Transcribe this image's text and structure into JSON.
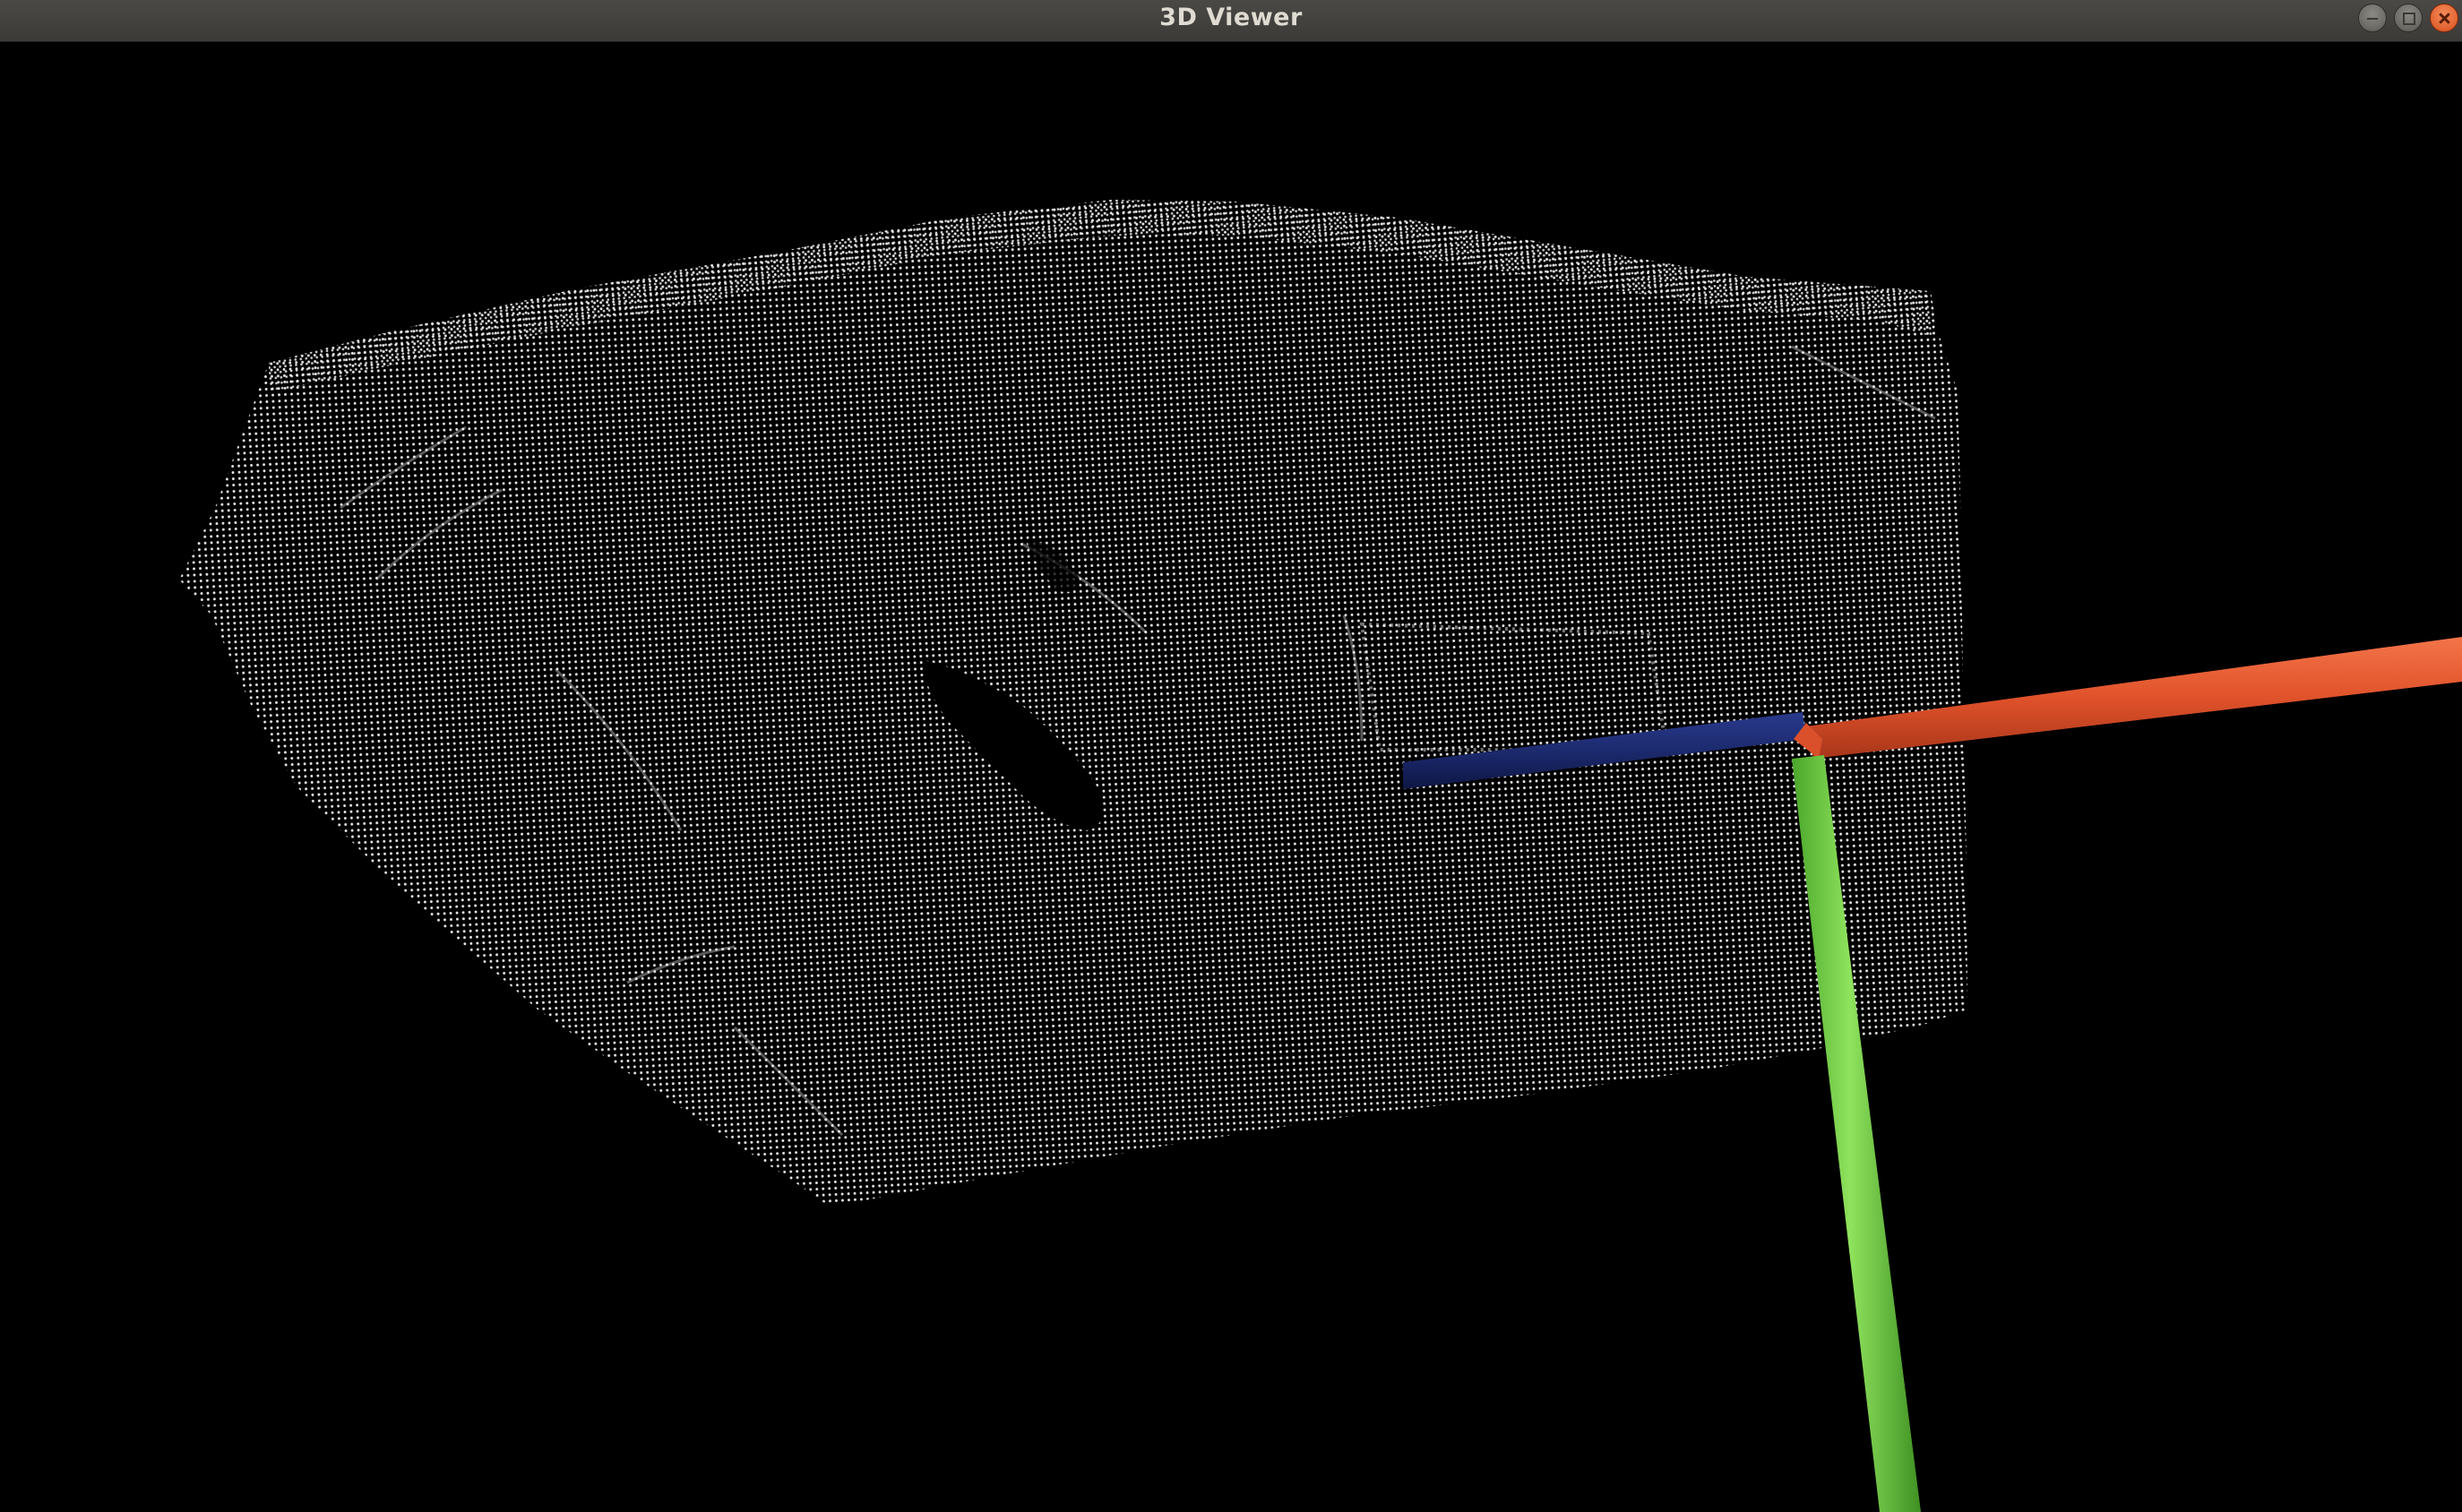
{
  "window": {
    "title": "3D Viewer"
  },
  "controls": {
    "minimize_icon": "minimize-icon",
    "maximize_icon": "maximize-icon",
    "close_icon": "close-icon"
  },
  "viewer": {
    "background_color": "#000000",
    "point_color": "#e8e8e8",
    "axes": {
      "x_color": "#e0522a",
      "y_color": "#6fcd3f",
      "z_color": "#1c2a6e"
    }
  }
}
